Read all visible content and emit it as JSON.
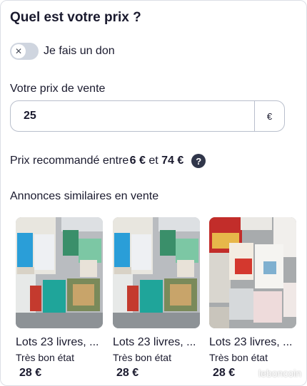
{
  "header": {
    "title": "Quel est votre prix ?"
  },
  "donation": {
    "label": "Je fais un don",
    "enabled": false,
    "icon": "close-icon"
  },
  "price": {
    "label": "Votre prix de vente",
    "value": "25",
    "currency": "€"
  },
  "recommendation": {
    "prefix": "Prix recommandé entre ",
    "min": "6 €",
    "middle": " et ",
    "max": "74 €",
    "help_icon": "?"
  },
  "similar": {
    "heading": "Annonces similaires en vente",
    "items": [
      {
        "title": "Lots 23 livres, ...",
        "condition": "Très bon état",
        "price": "28 €"
      },
      {
        "title": "Lots 23 livres, ...",
        "condition": "Très bon état",
        "price": "28 €"
      },
      {
        "title": "Lots 23 livres, ...",
        "condition": "Très bon état",
        "price": "28 €"
      }
    ]
  },
  "watermark": "leboncoin",
  "colors": {
    "text": "#1a1a2e",
    "toggle_off": "#cfd5df",
    "help_icon_bg": "#30364a",
    "border": "#b9bfcc"
  }
}
